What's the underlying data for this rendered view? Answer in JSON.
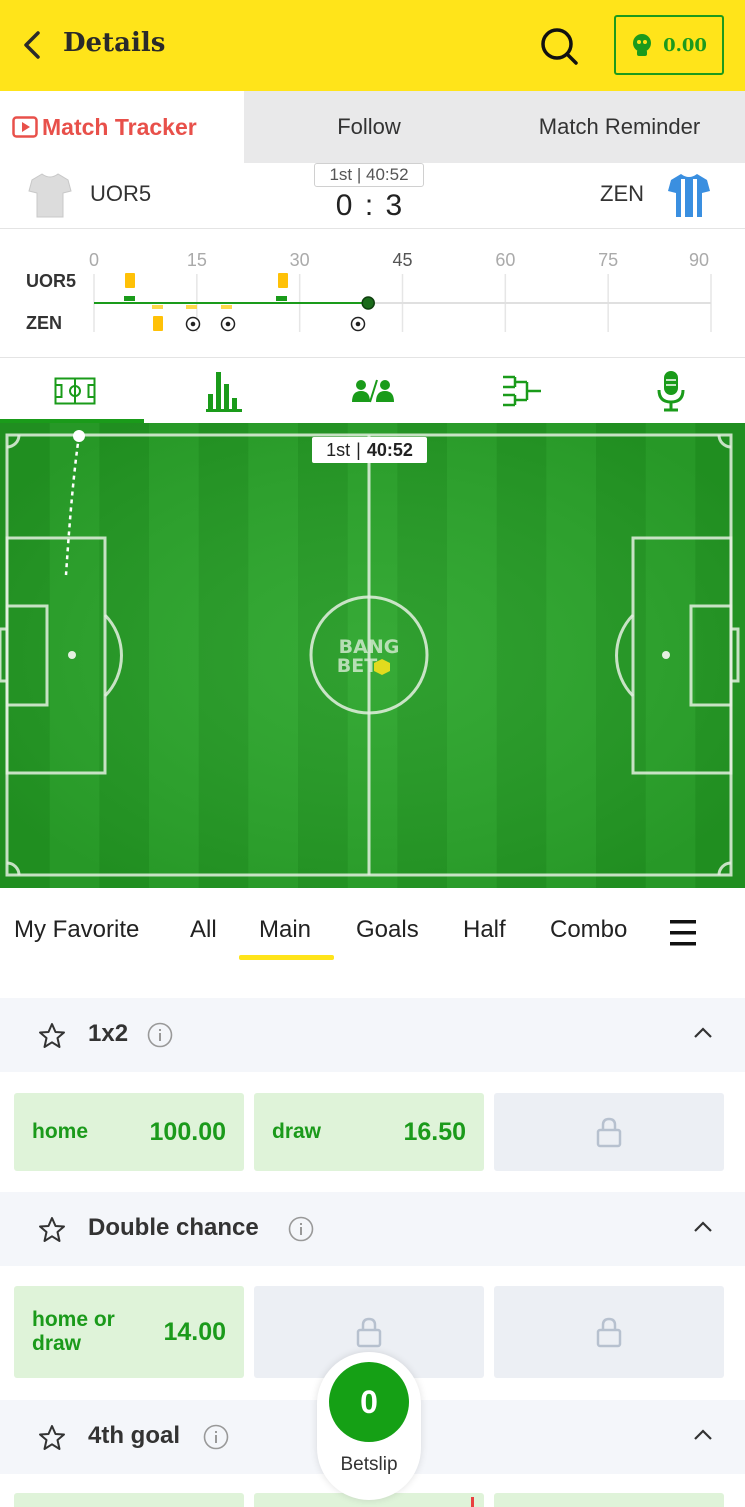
{
  "header": {
    "title": "Details",
    "balance": "0.00"
  },
  "top_tabs": {
    "tracker": "Match Tracker",
    "follow": "Follow",
    "reminder": "Match Reminder"
  },
  "match": {
    "home": "UOR5",
    "away": "ZEN",
    "period": "1st",
    "clock": "40:52",
    "period_clock": "1st | 40:52",
    "score_home": "0",
    "score_away": "3",
    "home_jersey_color": "#dcdcdc",
    "away_jersey_color": "#3a8fe0"
  },
  "timeline": {
    "ticks": [
      "0",
      "15",
      "30",
      "45",
      "60",
      "75",
      "90"
    ],
    "home_label": "UOR5",
    "away_label": "ZEN",
    "current_minute": 40
  },
  "pitch": {
    "brand": [
      "BANG",
      "BET"
    ]
  },
  "market_tabs": [
    "My Favorite",
    "All",
    "Main",
    "Goals",
    "Half",
    "Combo"
  ],
  "active_market_tab": "Main",
  "sections": {
    "s1": {
      "title": "1x2",
      "odds": [
        {
          "name": "home",
          "price": "100.00"
        },
        {
          "name": "draw",
          "price": "16.50"
        }
      ]
    },
    "s2": {
      "title": "Double chance",
      "odds": [
        {
          "name": "home or draw",
          "price": "14.00"
        }
      ]
    },
    "s3": {
      "title": "4th goal"
    }
  },
  "betslip": {
    "count": "0",
    "label": "Betslip"
  },
  "colors": {
    "brand_yellow": "#ffe41a",
    "green": "#1b9a1b",
    "tracker_red": "#e8504a"
  }
}
